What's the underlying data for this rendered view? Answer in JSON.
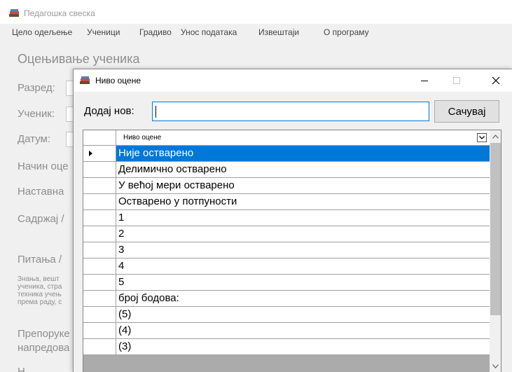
{
  "app": {
    "title": "Педагошка свеска",
    "icon": "books-icon"
  },
  "menu": {
    "items": [
      {
        "label": "Цело одељење"
      },
      {
        "label": "Ученици"
      },
      {
        "label": "Градиво"
      },
      {
        "label": "Унос података"
      },
      {
        "label": "Извештаји"
      },
      {
        "label": "О програму"
      }
    ]
  },
  "background": {
    "heading": "Оцењивање ученика",
    "labels": [
      "Разред:",
      "Ученик:",
      "Датум:",
      "Начин оце",
      "Наставна",
      "Садржај /",
      "Питања /"
    ],
    "small_text": [
      "Знања, вешт",
      "ученика, стра",
      "техника учењ",
      "према раду, с"
    ],
    "labels2": [
      "Препоруке",
      "напредова",
      "Н"
    ]
  },
  "dialog": {
    "title": "Ниво оцене",
    "icon": "books-icon",
    "add_label": "Додај нов:",
    "add_value": "",
    "save_label": "Сачувај",
    "grid": {
      "column_header": "Ниво оцене",
      "selected_index": 0,
      "rows": [
        "Није остварено",
        "Делимично остварено",
        "У већој мери остварено",
        "Остварено у потпуности",
        "1",
        "2",
        "3",
        "4",
        "5",
        "број бодова:",
        "(5)",
        "(4)",
        "(3)"
      ]
    }
  },
  "colors": {
    "selection": "#0078d7",
    "input_focus": "#0078d7"
  }
}
